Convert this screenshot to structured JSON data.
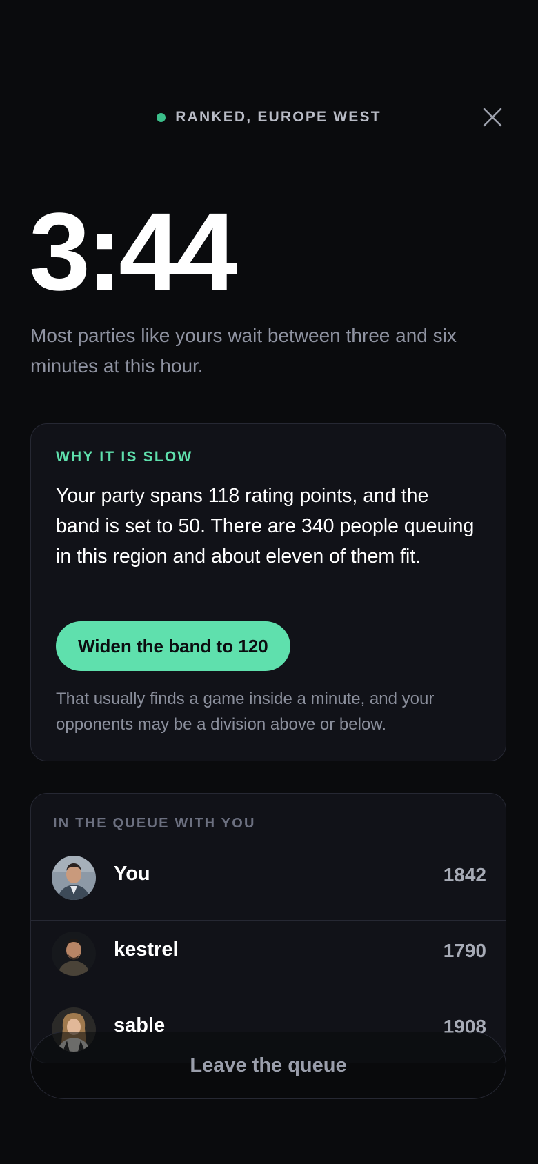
{
  "header": {
    "mode_label": "RANKED, EUROPE WEST",
    "status_color": "#3bbf8a"
  },
  "timer": {
    "elapsed": "3:44",
    "wait_text": "Most parties like yours wait between three and six minutes at this hour."
  },
  "slow_card": {
    "title": "WHY IT IS SLOW",
    "body": "Your party spans 118 rating points, and the band is set to 50. There are 340 people queuing in this region and about eleven of them fit.",
    "action_label": "Widen the band to 120",
    "note": "That usually finds a game inside a minute, and your opponents may be a division above or below.",
    "accent_color": "#5fe0ad"
  },
  "queue": {
    "title": "IN THE QUEUE WITH YOU",
    "players": [
      {
        "name": "You",
        "rating": "1842",
        "avatar": "avatar-photo"
      },
      {
        "name": "kestrel",
        "rating": "1790",
        "avatar": "avatar-photo"
      },
      {
        "name": "sable",
        "rating": "1908",
        "avatar": "avatar-photo"
      }
    ]
  },
  "footer": {
    "leave_label": "Leave the queue"
  },
  "icons": {
    "close": "close-icon"
  }
}
